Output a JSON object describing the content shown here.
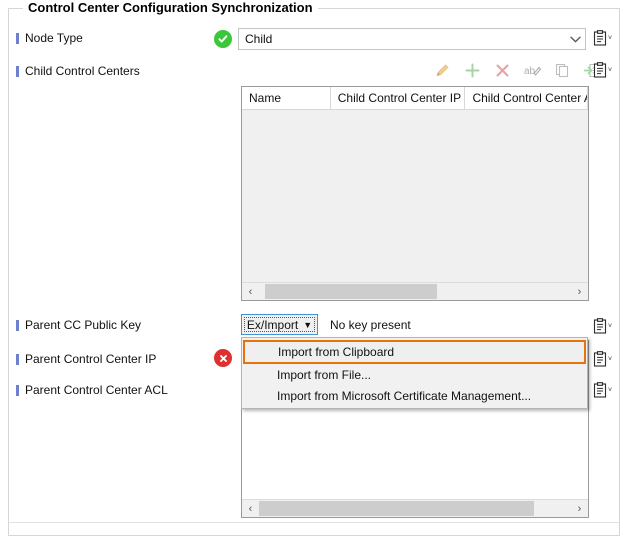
{
  "groupbox": {
    "title": "Control Center Configuration Synchronization"
  },
  "fields": {
    "node_type": {
      "label": "Node Type",
      "value": "Child",
      "status_icon": "check-circle-icon",
      "status_color": "#3cc63c"
    },
    "child_control_centers": {
      "label": "Child Control Centers"
    },
    "parent_cc_public_key": {
      "label": "Parent CC Public Key"
    },
    "parent_control_center_ip": {
      "label": "Parent Control Center IP",
      "status_icon": "error-circle-icon",
      "status_color": "#e02f2f"
    },
    "parent_control_center_acl": {
      "label": "Parent Control Center ACL"
    }
  },
  "toolbar": {
    "icons": [
      {
        "name": "edit-pencil-icon",
        "color": "#e8a33d"
      },
      {
        "name": "add-plus-icon",
        "color": "#5cb85c"
      },
      {
        "name": "delete-x-icon",
        "color": "#e05050"
      },
      {
        "name": "rename-ab-icon",
        "color": "#8a8a8a"
      },
      {
        "name": "copy-icon",
        "color": "#8a8a8a"
      },
      {
        "name": "paste-icon",
        "color": "#5cb85c"
      }
    ]
  },
  "child_grid": {
    "columns": [
      "Name",
      "Child Control Center IP",
      "Child Control Center AC"
    ],
    "rows": [],
    "hscroll": {
      "thumb_left_pct": 2,
      "thumb_width_pct": 55
    }
  },
  "acl_grid": {
    "hscroll": {
      "thumb_left_pct": 0,
      "thumb_width_pct": 88
    }
  },
  "eximport": {
    "label": "Ex/Import",
    "caret": "▼",
    "status_text": "No key present",
    "menu": [
      {
        "label": "Import from Clipboard",
        "highlighted": true
      },
      {
        "label": "Import from File...",
        "highlighted": false
      },
      {
        "label": "Import from Microsoft Certificate Management...",
        "highlighted": false
      }
    ]
  },
  "clipboard_buttons": {
    "icon": "clipboard-icon",
    "chevron": "˅",
    "count": 5
  },
  "scroll_arrows": {
    "left": "‹",
    "right": "›"
  }
}
